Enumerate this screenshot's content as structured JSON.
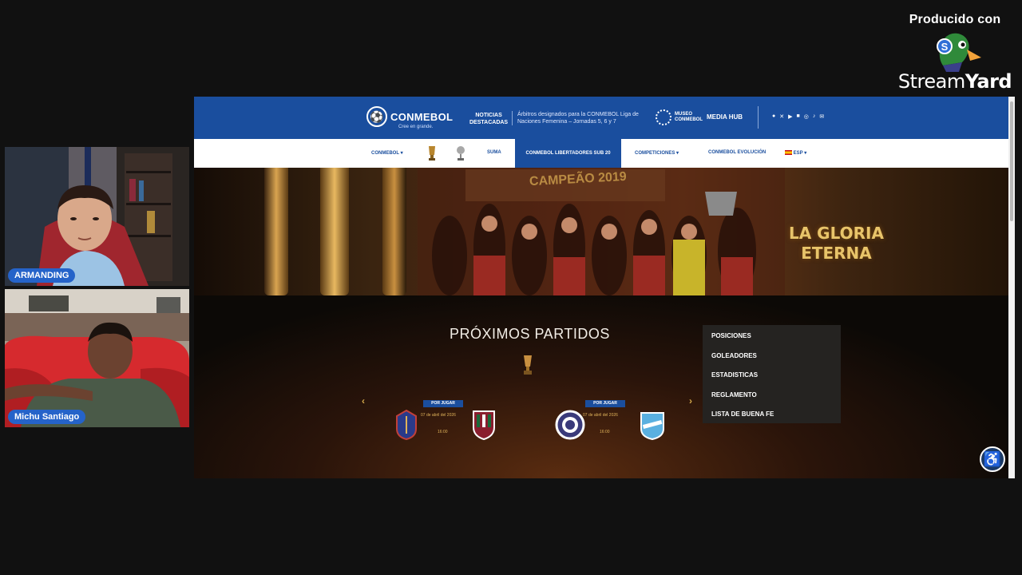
{
  "branding": {
    "produced_label": "Producido con",
    "brand_prefix": "Stream",
    "brand_suffix": "Yard"
  },
  "participants": [
    {
      "name": "ARMANDING"
    },
    {
      "name": "Michu Santiago"
    }
  ],
  "site": {
    "logo_text": "CONMEBOL",
    "logo_tagline": "Cree en grande.",
    "noticias_label_1": "NOTICIAS",
    "noticias_label_2": "DESTACADAS",
    "headline": "Árbitros designados para la CONMEBOL Liga de Naciones Femenina – Jornadas 5, 6 y 7",
    "museo_label_1": "MUSEO",
    "museo_label_2": "CONMEBOL",
    "media_hub": "MEDIA HUB",
    "social_icons": [
      "facebook-icon",
      "x-icon",
      "youtube-icon",
      "linkedin-icon",
      "instagram-icon",
      "tiktok-icon",
      "mail-icon"
    ],
    "nav": {
      "conmebol": "CONMEBOL",
      "suma": "SUMA",
      "active": "CONMEBOL LIBERTADORES SUB 20",
      "competiciones": "COMPETICIONES",
      "evolucion": "CONMEBOL EVOLUCIÓN",
      "lang": "ESP"
    },
    "hero": {
      "banner_text": "CAMPEÃO 2019",
      "title_line1": "LA GLORIA",
      "title_line2": "ETERNA"
    },
    "section_title": "PRÓXIMOS PARTIDOS",
    "matches": [
      {
        "status": "POR JUGAR",
        "date": "07 de abril del 2026",
        "time": "16:00",
        "home_crest": "club-crest-home-1",
        "away_crest": "fluminense-crest"
      },
      {
        "status": "POR JUGAR",
        "date": "07 de abril del 2026",
        "time": "16:00",
        "home_crest": "independiente-crest",
        "away_crest": "bolivar-crest"
      }
    ],
    "side_menu": [
      "POSICIONES",
      "GOLEADORES",
      "ESTADISTICAS",
      "REGLAMENTO",
      "LISTA DE BUENA FE"
    ],
    "colors": {
      "primary_blue": "#1a4e9e",
      "gold": "#e0b35a",
      "menu_bg": "#252321"
    }
  }
}
